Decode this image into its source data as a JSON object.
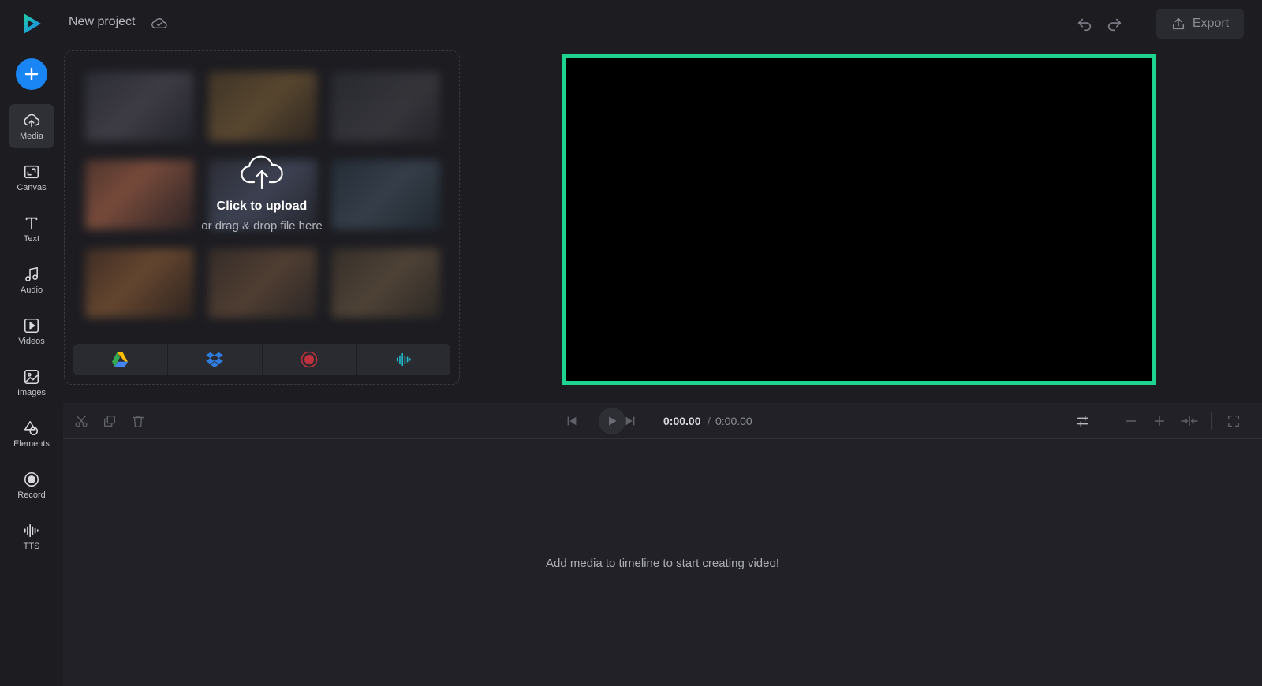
{
  "app": {
    "project_title": "New project",
    "export_label": "Export"
  },
  "sidebar": {
    "items": [
      {
        "label": "Media",
        "icon": "upload-cloud-icon"
      },
      {
        "label": "Canvas",
        "icon": "canvas-resize-icon"
      },
      {
        "label": "Text",
        "icon": "text-icon"
      },
      {
        "label": "Audio",
        "icon": "music-note-icon"
      },
      {
        "label": "Videos",
        "icon": "video-play-icon"
      },
      {
        "label": "Images",
        "icon": "image-icon"
      },
      {
        "label": "Elements",
        "icon": "shapes-icon"
      },
      {
        "label": "Record",
        "icon": "record-icon"
      },
      {
        "label": "TTS",
        "icon": "waveform-icon"
      }
    ]
  },
  "upload": {
    "title": "Click to upload",
    "subtitle": "or drag & drop file here",
    "sources": [
      "google-drive-icon",
      "dropbox-icon",
      "record-icon",
      "waveform-icon"
    ]
  },
  "timeline": {
    "current_time": "0:00.00",
    "separator": "/",
    "total_time": "0:00.00",
    "empty_message": "Add media to timeline to start creating video!"
  },
  "colors": {
    "accent": "#1a86f5",
    "preview_border": "#1ed28f",
    "background": "#1c1c21"
  }
}
